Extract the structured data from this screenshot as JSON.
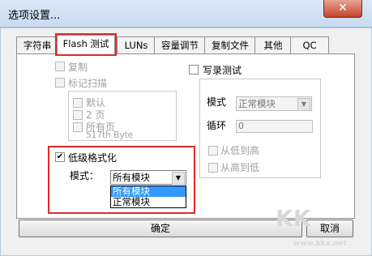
{
  "window": {
    "title": "选项设置...",
    "close_glyph": "✕"
  },
  "tabs": [
    {
      "label": "字符串"
    },
    {
      "label": "Flash 测试"
    },
    {
      "label": "LUNs"
    },
    {
      "label": "容量调节"
    },
    {
      "label": "复制文件"
    },
    {
      "label": "其他"
    },
    {
      "label": "QC"
    }
  ],
  "left": {
    "copy_label": "复制",
    "mark_scan_label": "标记扫描",
    "default_label": "默认",
    "two_pages_label": "2 页",
    "all_pages_label": "所有页",
    "byte_label": "517th Byte",
    "low_format_label": "低级格式化",
    "mode_label": "模式：",
    "mode_selected": "所有模块",
    "mode_options": [
      "所有模块",
      "正常模块"
    ]
  },
  "right": {
    "write_test_label": "写录测试",
    "mode_label": "模式",
    "mode_value": "正常模块",
    "loop_label": "循环",
    "loop_value": "0",
    "low_to_high_label": "从低到高",
    "high_to_low_label": "从高到低"
  },
  "buttons": {
    "ok": "确定",
    "cancel": "取消"
  },
  "watermark": {
    "logo": "KK",
    "url": "www.kkx.net"
  }
}
